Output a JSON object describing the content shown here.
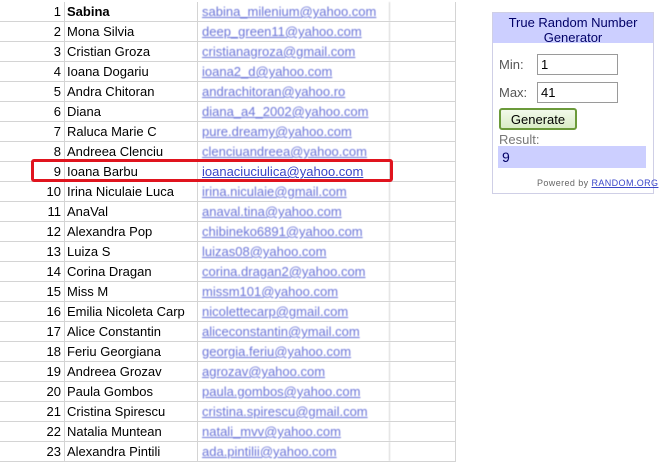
{
  "sheet": {
    "rows": [
      {
        "n": "1",
        "name": "Sabina",
        "email": "sabina_milenium@yahoo.com"
      },
      {
        "n": "2",
        "name": "Mona Silvia",
        "email": "deep_green11@yahoo.com"
      },
      {
        "n": "3",
        "name": "Cristian Groza",
        "email": "cristianagroza@gmail.com"
      },
      {
        "n": "4",
        "name": "Ioana Dogariu",
        "email": "ioana2_d@yahoo.com"
      },
      {
        "n": "5",
        "name": "Andra Chitoran",
        "email": "andrachitoran@yahoo.ro"
      },
      {
        "n": "6",
        "name": "Diana",
        "email": "diana_a4_2002@yahoo.com"
      },
      {
        "n": "7",
        "name": "Raluca Marie C",
        "email": "pure.dreamy@yahoo.com"
      },
      {
        "n": "8",
        "name": "Andreea Clenciu",
        "email": "clenciuandreea@yahoo.com"
      },
      {
        "n": "9",
        "name": "Ioana Barbu",
        "email": "ioanaciuciulica@yahoo.com"
      },
      {
        "n": "10",
        "name": "Irina Niculaie Luca",
        "email": "irina.niculaie@gmail.com"
      },
      {
        "n": "11",
        "name": "AnaVal",
        "email": "anaval.tina@yahoo.com"
      },
      {
        "n": "12",
        "name": "Alexandra Pop",
        "email": "chibineko6891@yahoo.com"
      },
      {
        "n": "13",
        "name": "Luiza S",
        "email": "luizas08@yahoo.com"
      },
      {
        "n": "14",
        "name": "Corina Dragan",
        "email": "corina.dragan2@yahoo.com"
      },
      {
        "n": "15",
        "name": "Miss M",
        "email": "missm101@yahoo.com"
      },
      {
        "n": "16",
        "name": "Emilia Nicoleta Carp",
        "email": "nicolettecarp@gmail.com"
      },
      {
        "n": "17",
        "name": "Alice Constantin",
        "email": "aliceconstantin@ymail.com"
      },
      {
        "n": "18",
        "name": "Feriu Georgiana",
        "email": "georgia.feriu@yahoo.com"
      },
      {
        "n": "19",
        "name": "Andreea Grozav",
        "email": "agrozav@yahoo.com"
      },
      {
        "n": "20",
        "name": "Paula Gombos",
        "email": "paula.gombos@yahoo.com"
      },
      {
        "n": "21",
        "name": "Cristina Spirescu",
        "email": "cristina.spirescu@gmail.com"
      },
      {
        "n": "22",
        "name": "Natalia Muntean",
        "email": "natali_mvv@yahoo.com"
      },
      {
        "n": "23",
        "name": "Alexandra Pintili",
        "email": "ada.pintilii@yahoo.com"
      }
    ],
    "highlighted_row": "9"
  },
  "rng": {
    "title": "True Random Number Generator",
    "min_label": "Min:",
    "min_value": "1",
    "max_label": "Max:",
    "max_value": "41",
    "generate_label": "Generate",
    "result_label": "Result:",
    "result_value": "9",
    "powered_prefix": "Powered by",
    "powered_link": "RANDOM.ORG"
  },
  "colors": {
    "highlight_border": "#e0141e",
    "link": "#3a46c8",
    "widget_header": "#cccfff",
    "button_border": "#6b9a3a"
  }
}
